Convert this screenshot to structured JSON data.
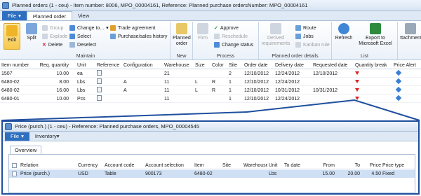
{
  "window": {
    "title": "Planned orders (1 - ceu) - Item number: 8006, MPO_00004161, Reference: Planned purchase ordersNumber: MPO_00004161"
  },
  "ribbon_tabs": {
    "file": "File",
    "planned_order": "Planned order",
    "view": "View"
  },
  "ribbon": {
    "maintain": {
      "label": "Maintain",
      "edit": "Edit",
      "split": "Split",
      "group": "Group",
      "explode": "Explode",
      "delete": "Delete",
      "change_to": "Change to...",
      "select": "Select",
      "deselect": "Deselect",
      "trade_agreement": "Trade agreement",
      "purchase_sales_history": "Purchase/sales history"
    },
    "new": {
      "label": "New",
      "planned_order": "Planned order"
    },
    "process": {
      "label": "Process",
      "firm": "Firm",
      "approve": "Approve",
      "reschedule": "Reschedule",
      "change_status": "Change status"
    },
    "details": {
      "label": "Planned order details",
      "derived_requirements": "Derived requirements",
      "route": "Route",
      "jobs": "Jobs",
      "kanban_rule": "Kanban rule"
    },
    "list": {
      "label": "List",
      "refresh": "Refresh",
      "export": "Export to Microsoft Excel"
    },
    "attachments": "Attachments"
  },
  "grid": {
    "columns": [
      "Item number",
      "Req. quantity",
      "Unit",
      "Reference",
      "Configuration",
      "Warehouse",
      "Size",
      "Color",
      "Site",
      "Order date",
      "Delivery date",
      "Requested date",
      "Quantity break",
      "Price Alert"
    ],
    "rows": [
      [
        "1507",
        "10.00",
        "ea",
        "",
        "",
        "21",
        "",
        "",
        "2",
        "12/10/2012",
        "12/24/2012",
        "12/10/2012",
        "",
        ""
      ],
      [
        "6480-02",
        "8.00",
        "Lbs",
        "",
        "A",
        "11",
        "L",
        "R",
        "1",
        "12/10/2012",
        "12/24/2012",
        "",
        "",
        ""
      ],
      [
        "6480-02",
        "16.00",
        "Lbs",
        "",
        "A",
        "11",
        "L",
        "R",
        "1",
        "12/10/2012",
        "10/31/2012",
        "10/31/2012",
        "",
        ""
      ],
      [
        "6480-01",
        "10.00",
        "Pcs",
        "",
        "",
        "11",
        "",
        "",
        "1",
        "12/10/2012",
        "12/24/2012",
        "",
        "",
        ""
      ]
    ]
  },
  "price_window": {
    "title": "Price (purch.) (1 - ceu) - Reference: Planned purchase orders, MPO_00004545",
    "file": "File",
    "inventory": "Inventory",
    "overview_tab": "Overview",
    "columns": [
      "Relation",
      "Currency",
      "Account code",
      "Account selection",
      "Item",
      "Site",
      "Warehouse",
      "Unit",
      "To date",
      "From",
      "To",
      "Price",
      "Price type"
    ],
    "row": [
      "Price (purch.)",
      "USD",
      "Table",
      "900173",
      "6480-02",
      "",
      "",
      "Lbs",
      "",
      "15.00",
      "20.00",
      "4.50",
      "Fixed"
    ]
  },
  "colors": {
    "accent": "#2f6fc0",
    "border": "#1f4f9e",
    "flag": "#dd2222",
    "alert": "#3b7ed6"
  }
}
